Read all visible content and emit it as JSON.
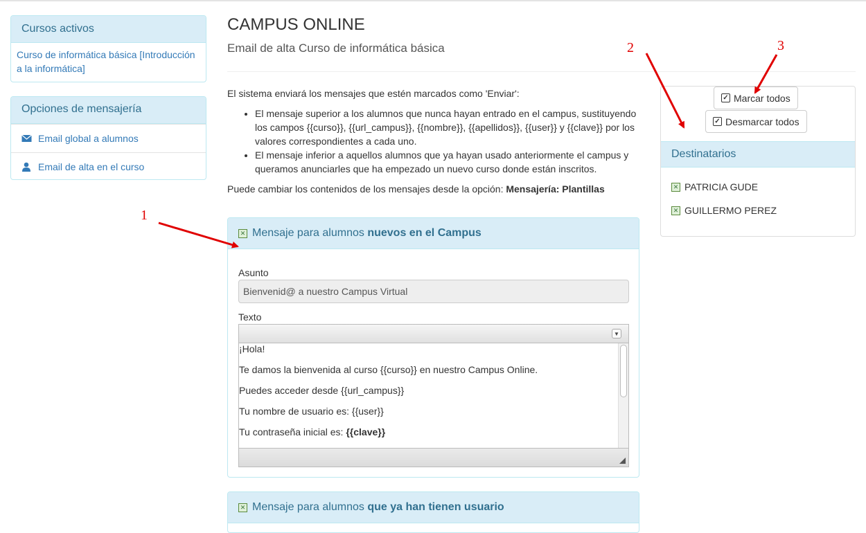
{
  "sidebar": {
    "active_courses": {
      "title": "Cursos activos",
      "course_link": "Curso de informática básica [Introducción a la informática]"
    },
    "messaging": {
      "title": "Opciones de mensajería",
      "items": [
        {
          "label": "Email global a alumnos",
          "icon": "envelope-icon"
        },
        {
          "label": "Email de alta en el curso",
          "icon": "user-icon"
        }
      ]
    }
  },
  "header": {
    "title": "CAMPUS ONLINE",
    "subtitle": "Email de alta Curso de informática básica"
  },
  "intro": {
    "lead": "El sistema enviará los mensajes que estén marcados como 'Enviar':",
    "bullets": [
      "El mensaje superior a los alumnos que nunca hayan entrado en el campus, sustituyendo los campos {{curso}}, {{url_campus}}, {{nombre}}, {{apellidos}}, {{user}} y {{clave}} por los valores correspondientes a cada uno.",
      "El mensaje inferior a aquellos alumnos que ya hayan usado anteriormente el campus y queramos anunciarles que ha empezado un nuevo curso donde están inscritos."
    ],
    "footer_prefix": "Puede cambiar los contenidos de los mensajes desde la opción:",
    "footer_bold": "Mensajería: Plantillas"
  },
  "message_new": {
    "heading_prefix": "Mensaje para alumnos",
    "heading_bold": "nuevos en el Campus",
    "subject_label": "Asunto",
    "subject_value": "Bienvenid@ a nuestro Campus Virtual",
    "text_label": "Texto",
    "body_lines": [
      "¡Hola!",
      "Te damos la bienvenida al curso {{curso}} en nuestro Campus Online.",
      "Puedes acceder desde {{url_campus}}",
      "Tu nombre de usuario es: {{user}}"
    ],
    "password_prefix": "Tu contraseña inicial es:",
    "password_bold": "{{clave}}"
  },
  "message_existing": {
    "heading_prefix": "Mensaje para alumnos",
    "heading_bold": "que ya han tienen usuario"
  },
  "recipients": {
    "mark_all": "Marcar todos",
    "unmark_all": "Desmarcar todos",
    "title": "Destinatarios",
    "list": [
      "PATRICIA GUDE",
      "GUILLERMO PEREZ"
    ]
  },
  "annotations": [
    "1",
    "2",
    "3"
  ],
  "colors": {
    "panel_heading_bg": "#d9edf7",
    "panel_heading_text": "#31708f",
    "link": "#337ab7",
    "annotation": "#e00000"
  }
}
